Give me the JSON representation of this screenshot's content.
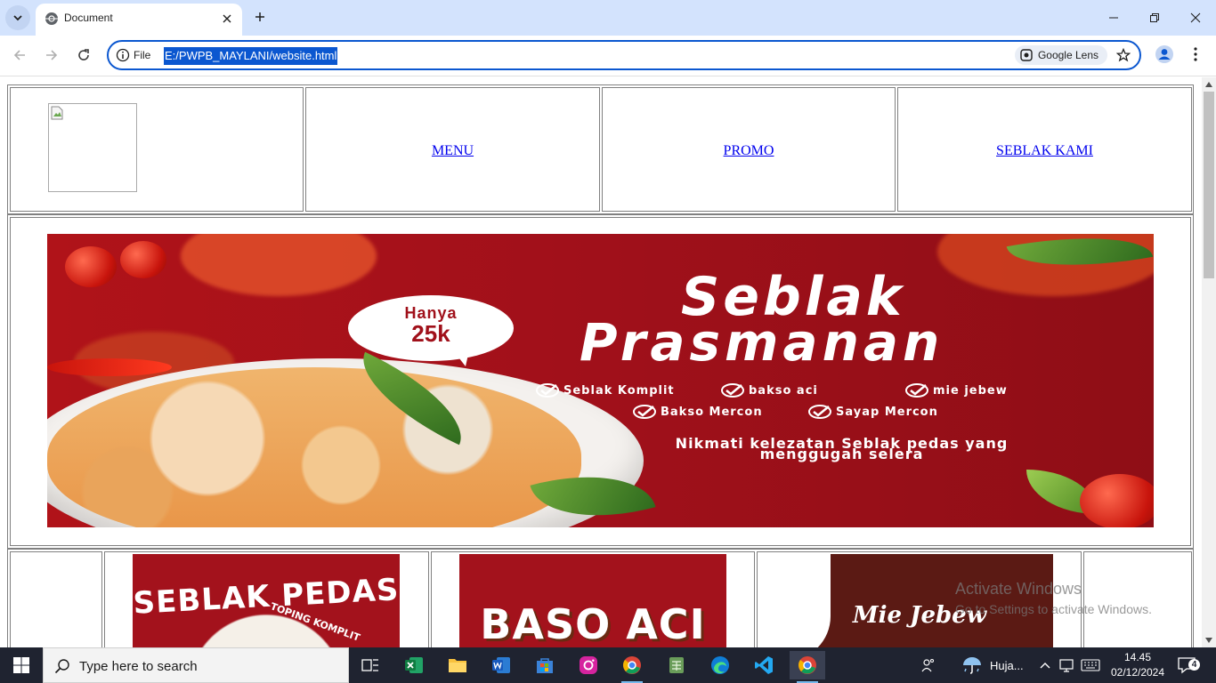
{
  "browser": {
    "tab_title": "Document",
    "omnibox_scheme_label": "File",
    "url": "E:/PWPB_MAYLANI/website.html",
    "lens_label": "Google Lens"
  },
  "page": {
    "nav": [
      {
        "label": "MENU"
      },
      {
        "label": "PROMO"
      },
      {
        "label": "SEBLAK KAMI"
      }
    ],
    "banner": {
      "price_top": "Hanya",
      "price_bottom": "25k",
      "title_line1": "Seblak",
      "title_line2": "Prasmanan",
      "features": [
        "Seblak Komplit",
        "bakso aci",
        "mie jebew",
        "Bakso Mercon",
        "Sayap Mercon"
      ],
      "tagline_line1": "Nikmati kelezatan Seblak pedas yang",
      "tagline_line2": "menggugah selera"
    },
    "cards": [
      {
        "title": "SEBLAK PEDAS",
        "subtitle": "TOPING KOMPLIT"
      },
      {
        "title": "BASO ACI"
      },
      {
        "title": "Mie Jebew"
      }
    ]
  },
  "watermark": {
    "line1": "Activate Windows",
    "line2": "Go to Settings to activate Windows."
  },
  "taskbar": {
    "search_placeholder": "Type here to search",
    "weather_label": "Huja...",
    "time": "14.45",
    "date": "02/12/2024",
    "notification_count": "4"
  },
  "colors": {
    "tabstrip": "#d3e3fd",
    "omnibox_border": "#0b57d0",
    "banner_red": "#a0101a",
    "link": "#0000ee",
    "taskbar": "#1f2330"
  }
}
